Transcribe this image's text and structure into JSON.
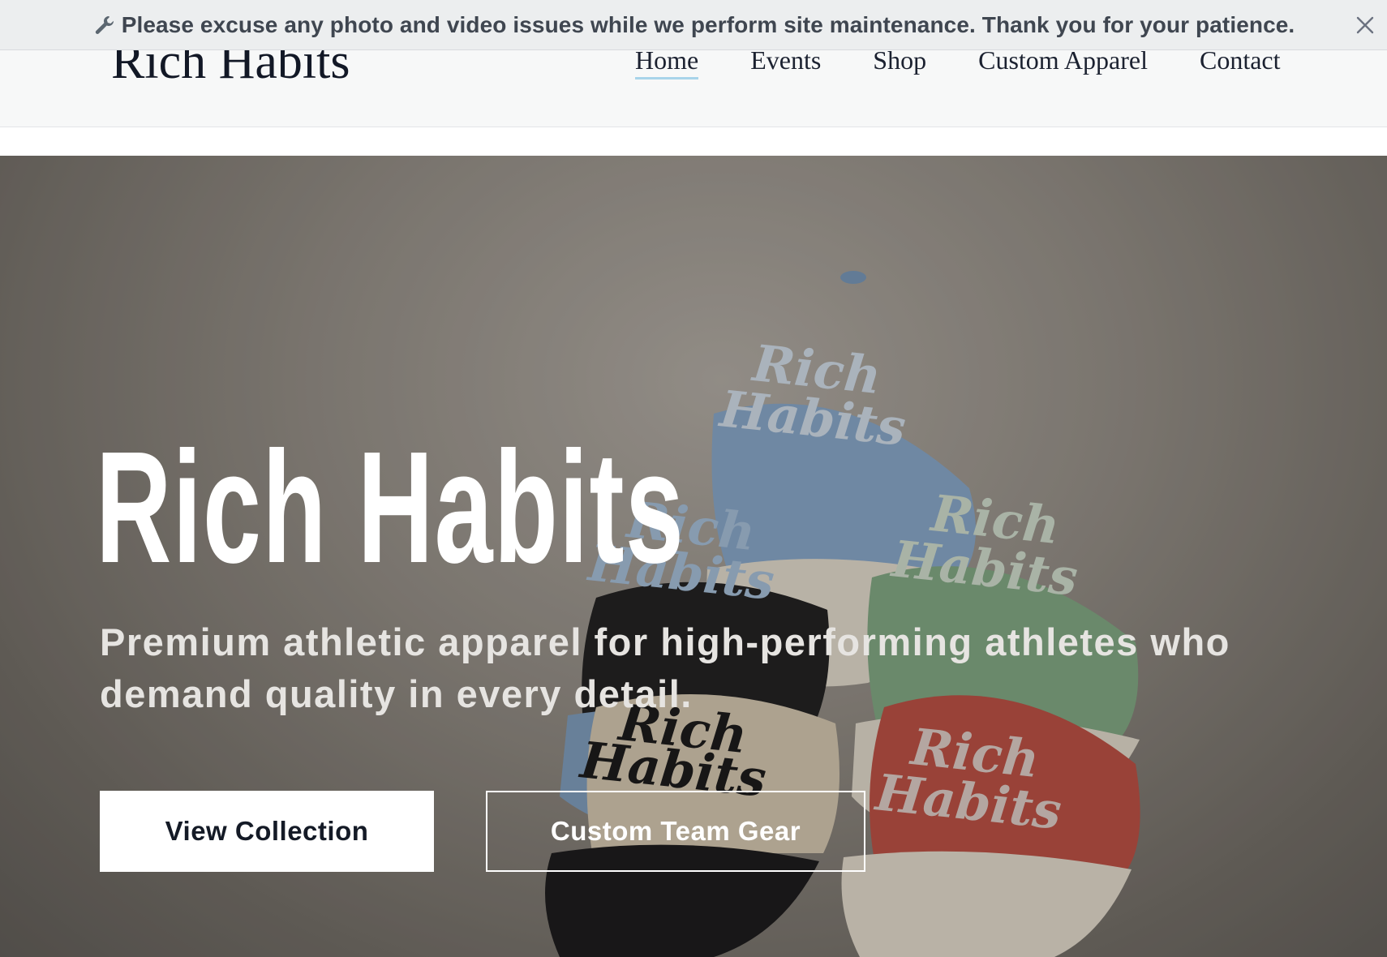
{
  "banner": {
    "icon": "wrench-icon",
    "text": "Please excuse any photo and video issues while we perform site maintenance. Thank you for your patience.",
    "close_icon": "close-icon"
  },
  "header": {
    "logo": "Rich Habits",
    "nav": [
      {
        "label": "Home",
        "active": true
      },
      {
        "label": "Events",
        "active": false
      },
      {
        "label": "Shop",
        "active": false
      },
      {
        "label": "Custom Apparel",
        "active": false
      },
      {
        "label": "Contact",
        "active": false
      }
    ]
  },
  "hero": {
    "title": "Rich Habits",
    "subtitle": "Premium athletic apparel for high-performing athletes who demand quality in every detail.",
    "primary_button": "View Collection",
    "secondary_button": "Custom Team Gear",
    "cap_text": "Rich Habits",
    "caps": [
      {
        "crown": "#7f9fc0",
        "brim": "#d8d2c4",
        "logo": "#c7d3de"
      },
      {
        "crown": "#79a07c",
        "brim": "#d7d1c3",
        "logo": "#c6d3c4"
      },
      {
        "crown": "#1b1b1c",
        "brim": "#7795b4",
        "logo": "#9db6cf"
      },
      {
        "crown": "#cbbfa8",
        "brim": "#151516",
        "logo": "#141414"
      },
      {
        "crown": "#b24a3e",
        "brim": "#d9d2c4",
        "logo": "#d4c4bd"
      }
    ]
  },
  "colors": {
    "banner_bg": "#eceeef",
    "header_bg": "#f7f8f8",
    "nav_active_underline": "#a8d4ea"
  }
}
